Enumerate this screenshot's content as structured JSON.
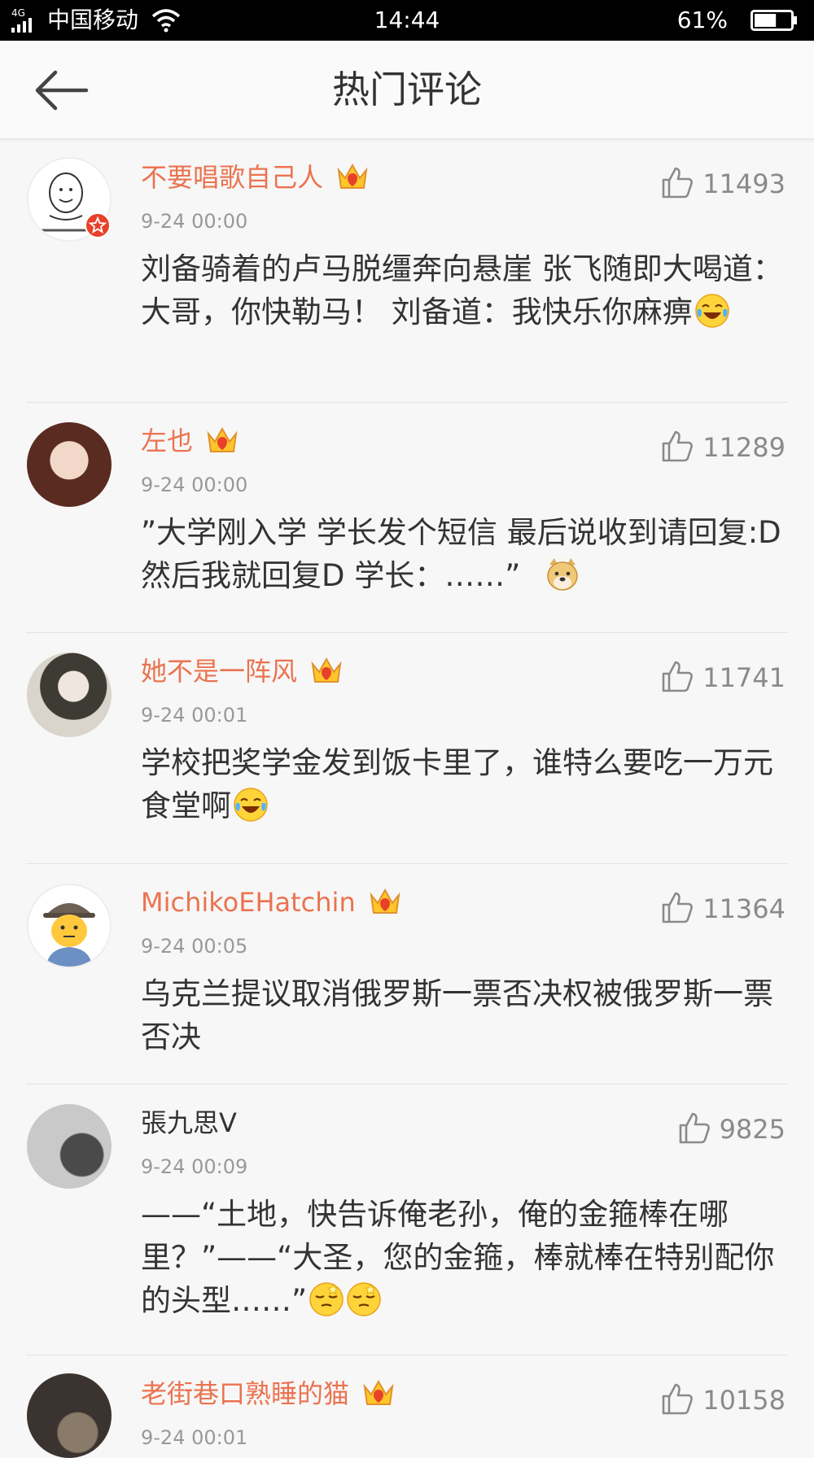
{
  "status_bar": {
    "network": "4G",
    "carrier": "中国移动",
    "time": "14:44",
    "battery_percent": "61%",
    "battery_level": 0.61,
    "icons": [
      "signal-icon",
      "wifi-icon",
      "battery-icon"
    ]
  },
  "nav": {
    "title": "热门评论",
    "back_icon": "back-arrow-icon"
  },
  "colors": {
    "username": "#eb7350",
    "timestamp": "#999999",
    "text": "#333333",
    "background": "#f7f7f7"
  },
  "comments": [
    {
      "user": "不要唱歌自己人",
      "vip": true,
      "verified": true,
      "time": "9-24 00:00",
      "likes": "11493",
      "text": "刘备骑着的卢马脱缰奔向悬崖 张飞随即大喝道：大哥，你快勒马！ 刘备道：我快乐你麻痹",
      "emoji": [
        "laughing-tears-emoji"
      ]
    },
    {
      "user": "左也",
      "vip": true,
      "time": "9-24 00:00",
      "likes": "11289",
      "text": "”大学刚入学  学长发个短信 最后说收到请回复:D   然后我就回复D   学长：……”",
      "emoji": [
        "doge-emoji"
      ]
    },
    {
      "user": "她不是一阵风",
      "vip": true,
      "time": "9-24 00:01",
      "likes": "11741",
      "text": "学校把奖学金发到饭卡里了，谁特么要吃一万元食堂啊",
      "emoji": [
        "laughing-tears-emoji"
      ]
    },
    {
      "user": "MichikoEHatchin",
      "vip": true,
      "time": "9-24 00:05",
      "likes": "11364",
      "text": "乌克兰提议取消俄罗斯一票否决权被俄罗斯一票否决",
      "emoji": []
    },
    {
      "user": "張九思V",
      "vip": false,
      "time": "9-24 00:09",
      "likes": "9825",
      "text": "——“土地，快告诉俺老孙，俺的金箍棒在哪里？”——“大圣，您的金箍，棒就棒在特别配你的头型……”",
      "emoji": [
        "dizzy-emoji",
        "dizzy-emoji"
      ]
    },
    {
      "user": "老街巷口熟睡的猫",
      "vip": true,
      "time": "9-24 00:01",
      "likes": "10158",
      "text": "",
      "emoji": []
    }
  ]
}
